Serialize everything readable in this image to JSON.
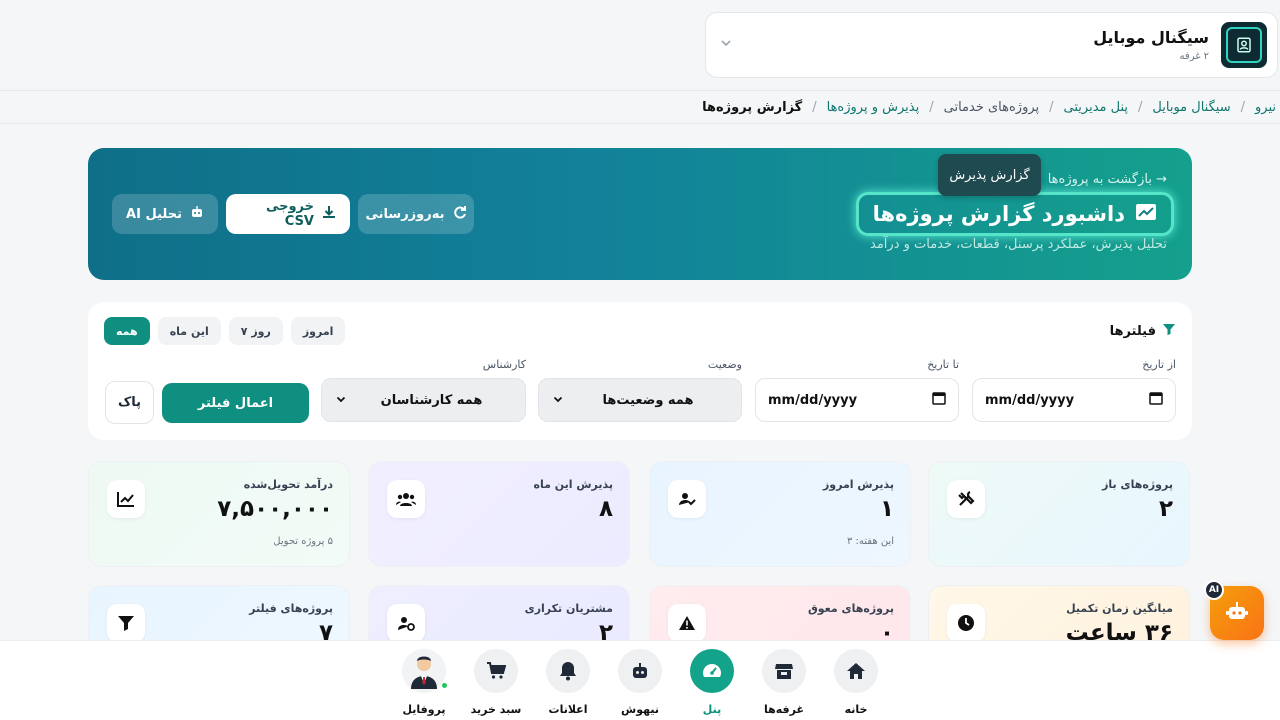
{
  "shop": {
    "name": "سیگنال موبایل",
    "subtitle": "۲ غرفه"
  },
  "breadcrumb": [
    "نیرو",
    "سیگنال موبایل",
    "پنل مدیریتی",
    "پروژه‌های خدماتی",
    "پذیرش و پروژه‌ها",
    "گزارش پروژه‌ها"
  ],
  "hero": {
    "back_label": "بازگشت به پروژه‌ها",
    "tooltip": "گزارش پذیرش",
    "title": "داشبورد گزارش پروژه‌ها",
    "subtitle": "تحلیل پذیرش، عملکرد پرسنل، قطعات، خدمات و درآمد",
    "refresh_label": "به‌روزرسانی",
    "csv_label": "خروجی CSV",
    "ai_label": "تحلیل AI"
  },
  "filters": {
    "title": "فیلترها",
    "chips": [
      "همه",
      "این ماه",
      "۷ روز",
      "امروز"
    ],
    "from_label": "از تاریخ",
    "from_value": "mm/dd/yyyy",
    "to_label": "تا تاریخ",
    "to_value": "mm/dd/yyyy",
    "status_label": "وضعیت",
    "status_value": "همه وضعیت‌ها",
    "tech_label": "کارشناس",
    "tech_value": "همه کارشناسان",
    "apply_label": "اعمال فیلتر",
    "clear_label": "پاک"
  },
  "stats": [
    {
      "label": "پروژه‌های باز",
      "value": "۲",
      "note": "",
      "icon": "tools-icon"
    },
    {
      "label": "پذیرش امروز",
      "value": "۱",
      "note": "این هفته: ۳",
      "icon": "user-check-icon"
    },
    {
      "label": "پذیرش این ماه",
      "value": "۸",
      "note": "",
      "icon": "users-icon"
    },
    {
      "label": "درآمد تحویل‌شده",
      "value": "۷,۵۰۰,۰۰۰",
      "note": "۵ پروژه تحویل",
      "icon": "chart-line-icon"
    },
    {
      "label": "میانگین زمان تکمیل",
      "value": "۳۶ ساعت",
      "note": "",
      "icon": "clock-icon"
    },
    {
      "label": "پروژه‌های معوق",
      "value": "۰",
      "note": "",
      "icon": "warning-icon"
    },
    {
      "label": "مشتریان تکراری",
      "value": "۲",
      "note": "",
      "icon": "user-repeat-icon"
    },
    {
      "label": "پروژه‌های فیلتر",
      "value": "۷",
      "note": "",
      "icon": "filter-icon"
    }
  ],
  "fab": {
    "badge": "AI"
  },
  "nav": [
    {
      "label": "خانه",
      "icon": "home-icon"
    },
    {
      "label": "غرفه‌ها",
      "icon": "store-icon"
    },
    {
      "label": "پنل",
      "icon": "dashboard-icon"
    },
    {
      "label": "نیهوش",
      "icon": "robot-icon"
    },
    {
      "label": "اعلانات",
      "icon": "bell-icon"
    },
    {
      "label": "سبد خرید",
      "icon": "cart-icon"
    },
    {
      "label": "پروفایل",
      "icon": "avatar"
    }
  ],
  "colors": {
    "accent": "#0f8f7f",
    "hero_start": "#0f6f88",
    "hero_end": "#14a08c",
    "fab": "#f97316"
  }
}
